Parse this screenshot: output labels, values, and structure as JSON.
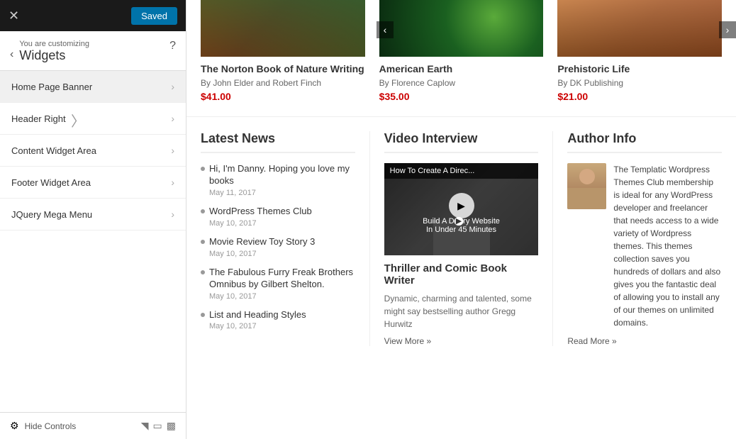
{
  "topbar": {
    "close_label": "✕",
    "saved_label": "Saved"
  },
  "customizing": {
    "back_arrow": "‹",
    "you_are_label": "You are customizing",
    "widgets_title": "Widgets",
    "help_label": "?"
  },
  "nav_items": [
    {
      "id": "home-page-banner",
      "label": "Home Page Banner",
      "active": true
    },
    {
      "id": "header-right",
      "label": "Header Right",
      "active": false
    },
    {
      "id": "content-widget-area",
      "label": "Content Widget Area",
      "active": false
    },
    {
      "id": "footer-widget-area",
      "label": "Footer Widget Area",
      "active": false
    },
    {
      "id": "jquery-mega-menu",
      "label": "JQuery Mega Menu",
      "active": false
    }
  ],
  "bottom_bar": {
    "hide_controls_label": "Hide Controls"
  },
  "books_nav": {
    "prev_arrow": "‹",
    "next_arrow": "›"
  },
  "books": [
    {
      "title": "The Norton Book of Nature Writing",
      "author": "By John Elder and Robert Finch",
      "price": "$41.00",
      "cover_class": "cover-norton"
    },
    {
      "title": "American Earth",
      "author": "By Florence Caplow",
      "price": "$35.00",
      "cover_class": "cover-earth"
    },
    {
      "title": "Prehistoric Life",
      "author": "By DK Publishing",
      "price": "$21.00",
      "cover_class": "cover-prehistoric"
    }
  ],
  "latest_news": {
    "title": "Latest News",
    "items": [
      {
        "title": "Hi, I'm Danny. Hoping you love my books",
        "date": "May 11, 2017"
      },
      {
        "title": "WordPress Themes Club",
        "date": "May 10, 2017"
      },
      {
        "title": "Movie Review Toy Story 3",
        "date": "May 10, 2017"
      },
      {
        "title": "The Fabulous Furry Freak Brothers Omnibus by Gilbert Shelton.",
        "date": "May 10, 2017"
      },
      {
        "title": "List and Heading Styles",
        "date": "May 10, 2017"
      }
    ]
  },
  "video_interview": {
    "title": "Video Interview",
    "video_title_bar": "How To Create A Direc...",
    "video_subtitle_line1": "Build A D",
    "video_subtitle_line2": "In Under 45 Minutes",
    "interview_title": "Thriller and Comic Book Writer",
    "description": "Dynamic, charming and talented, some might say bestselling author Gregg Hurwitz",
    "view_more_label": "View More »"
  },
  "author_info": {
    "title": "Author Info",
    "body": "The Templatic Wordpress Themes Club membership is ideal for any WordPress developer and freelancer that needs access to a wide variety of Wordpress themes. This themes collection saves you hundreds of dollars and also gives you the fantastic deal of allowing you to install any of our themes on unlimited domains.",
    "read_more_label": "Read More »"
  }
}
